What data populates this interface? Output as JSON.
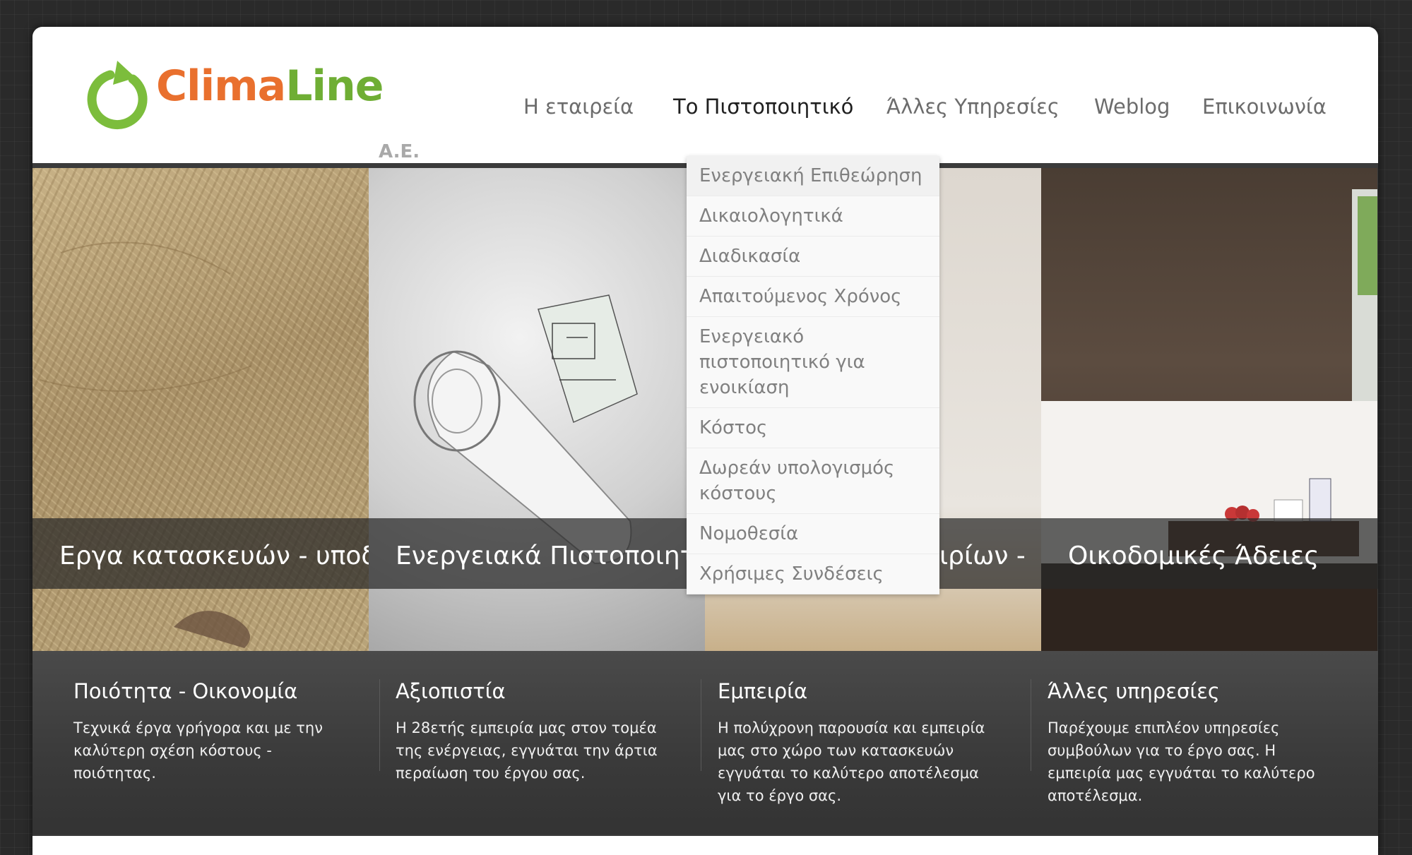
{
  "logo": {
    "name_part1": "Clima",
    "name_part2": "Line",
    "suffix": "A.E."
  },
  "nav": {
    "items": [
      {
        "label": "Η εταιρεία"
      },
      {
        "label": "Το Πιστοποιητικό"
      },
      {
        "label": "Άλλες Υπηρεσίες"
      },
      {
        "label": "Weblog"
      },
      {
        "label": "Επικοινωνία"
      }
    ],
    "active": "Το Πιστοποιητικό"
  },
  "dropdown": {
    "items": [
      {
        "label": "Ενεργειακή Επιθεώρηση"
      },
      {
        "label": "Δικαιολογητικά"
      },
      {
        "label": "Διαδικασία"
      },
      {
        "label": "Απαιτούμενος Χρόνος"
      },
      {
        "label": "Ενεργειακό πιστοποιητικό για ενοικίαση"
      },
      {
        "label": "Κόστος"
      },
      {
        "label": "Δωρεάν υπολογισμός κόστους"
      },
      {
        "label": "Νομοθεσία"
      },
      {
        "label": "Χρήσιμες Συνδέσεις"
      }
    ]
  },
  "slider": {
    "captions": [
      {
        "text": "Εργα κατασκευών - υποδομ"
      },
      {
        "text": "Ενεργειακά Πιστοποιητ"
      },
      {
        "text": "ιρίων -"
      },
      {
        "text": "Οικοδομικές Άδειες"
      }
    ]
  },
  "features": [
    {
      "title": "Ποιότητα - Οικονομία",
      "text": "Τεχνικά έργα γρήγορα και με την καλύτερη σχέση κόστους - ποιότητας."
    },
    {
      "title": "Αξιοπιστία",
      "text": "Η 28ετής εμπειρία μας στον τομέα της ενέργειας, εγγυάται την άρτια περαίωση του έργου σας."
    },
    {
      "title": "Εμπειρία",
      "text": "Η πολύχρονη παρουσία και εμπειρία μας στο χώρο των κατασκευών εγγυάται το καλύτερο αποτέλεσμα για το έργο σας."
    },
    {
      "title": "Άλλες υπηρεσίες",
      "text": "Παρέχουμε επιπλέον υπηρεσίες συμβούλων για το έργο σας. Η εμπειρία μας εγγυάται το καλύτερο αποτέλεσμα."
    }
  ],
  "colors": {
    "logo_orange": "#e9702e",
    "logo_green": "#6fae34",
    "background": "#2a2a2a"
  },
  "icons": {
    "logo_mark": "circular-arrow-icon"
  }
}
